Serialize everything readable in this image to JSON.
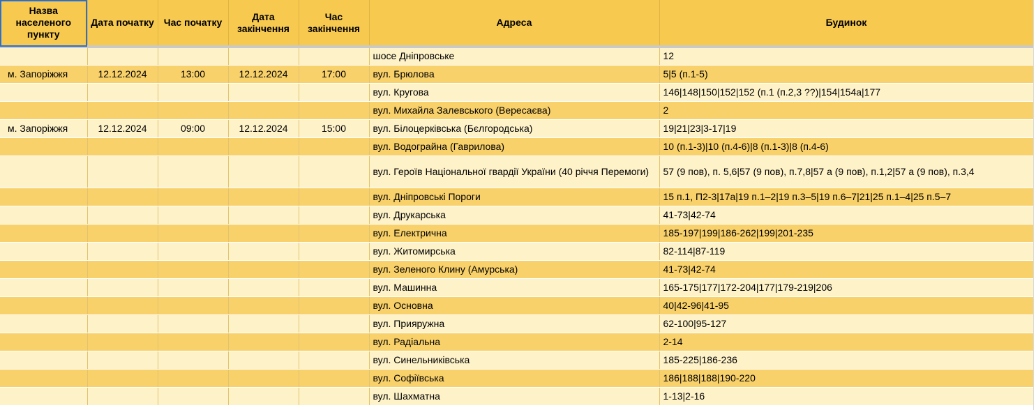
{
  "headers": [
    "Назва населеного пункту",
    "Дата початку",
    "Час початку",
    "Дата закінчення",
    "Час закінчення",
    "Адреса",
    "Будинок"
  ],
  "rows": [
    {
      "town": "",
      "start_date": "",
      "start_time": "",
      "end_date": "",
      "end_time": "",
      "address": "шосе Дніпровське",
      "house": "12"
    },
    {
      "town": "м. Запоріжжя",
      "start_date": "12.12.2024",
      "start_time": "13:00",
      "end_date": "12.12.2024",
      "end_time": "17:00",
      "address": "вул. Брюлова",
      "house": "5|5 (п.1-5)"
    },
    {
      "town": "",
      "start_date": "",
      "start_time": "",
      "end_date": "",
      "end_time": "",
      "address": "вул. Кругова",
      "house": "146|148|150|152|152 (п.1 (п.2,3 ??)|154|154а|177"
    },
    {
      "town": "",
      "start_date": "",
      "start_time": "",
      "end_date": "",
      "end_time": "",
      "address": "вул. Михайла Залевського (Вересаєва)",
      "house": "2"
    },
    {
      "town": "м. Запоріжжя",
      "start_date": "12.12.2024",
      "start_time": "09:00",
      "end_date": "12.12.2024",
      "end_time": "15:00",
      "address": "вул. Білоцерківська (Бєлгородська)",
      "house": "19|21|23|3-17|19"
    },
    {
      "town": "",
      "start_date": "",
      "start_time": "",
      "end_date": "",
      "end_time": "",
      "address": "вул. Водограйна (Гаврилова)",
      "house": "10 (п.1-3)|10 (п.4-6)|8 (п.1-3)|8 (п.4-6)"
    },
    {
      "town": "",
      "start_date": "",
      "start_time": "",
      "end_date": "",
      "end_time": "",
      "address": "вул. Героїв Національної гвардії України (40 річчя Перемоги)",
      "house": "57 (9 пов), п. 5,6|57 (9 пов), п.7,8|57 а (9 пов), п.1,2|57 а (9 пов), п.3,4",
      "tall": true
    },
    {
      "town": "",
      "start_date": "",
      "start_time": "",
      "end_date": "",
      "end_time": "",
      "address": "вул. Дніпровські Пороги",
      "house": "15 п.1, П2-3|17а|19 п.1–2|19 п.3–5|19 п.6–7|21|25 п.1–4|25 п.5–7"
    },
    {
      "town": "",
      "start_date": "",
      "start_time": "",
      "end_date": "",
      "end_time": "",
      "address": "вул. Друкарська",
      "house": "41-73|42-74"
    },
    {
      "town": "",
      "start_date": "",
      "start_time": "",
      "end_date": "",
      "end_time": "",
      "address": "вул. Електрична",
      "house": "185-197|199|186-262|199|201-235"
    },
    {
      "town": "",
      "start_date": "",
      "start_time": "",
      "end_date": "",
      "end_time": "",
      "address": "вул. Житомирська",
      "house": "82-114|87-119"
    },
    {
      "town": "",
      "start_date": "",
      "start_time": "",
      "end_date": "",
      "end_time": "",
      "address": "вул. Зеленого Клину (Амурська)",
      "house": "41-73|42-74"
    },
    {
      "town": "",
      "start_date": "",
      "start_time": "",
      "end_date": "",
      "end_time": "",
      "address": "вул. Машинна",
      "house": "165-175|177|172-204|177|179-219|206"
    },
    {
      "town": "",
      "start_date": "",
      "start_time": "",
      "end_date": "",
      "end_time": "",
      "address": "вул. Основна",
      "house": "40|42-96|41-95"
    },
    {
      "town": "",
      "start_date": "",
      "start_time": "",
      "end_date": "",
      "end_time": "",
      "address": "вул. Прияружна",
      "house": "62-100|95-127"
    },
    {
      "town": "",
      "start_date": "",
      "start_time": "",
      "end_date": "",
      "end_time": "",
      "address": "вул. Радіальна",
      "house": "2-14"
    },
    {
      "town": "",
      "start_date": "",
      "start_time": "",
      "end_date": "",
      "end_time": "",
      "address": "вул. Синельниківська",
      "house": "185-225|186-236"
    },
    {
      "town": "",
      "start_date": "",
      "start_time": "",
      "end_date": "",
      "end_time": "",
      "address": "вул. Софіївська",
      "house": "186|188|188|190-220"
    },
    {
      "town": "",
      "start_date": "",
      "start_time": "",
      "end_date": "",
      "end_time": "",
      "address": "вул. Шахматна",
      "house": "1-13|2-16"
    }
  ],
  "colors": {
    "header_bg": "#f7c94f",
    "row_light": "#fef2c9",
    "row_dark": "#f8d16b",
    "selection": "#2f6fca"
  }
}
